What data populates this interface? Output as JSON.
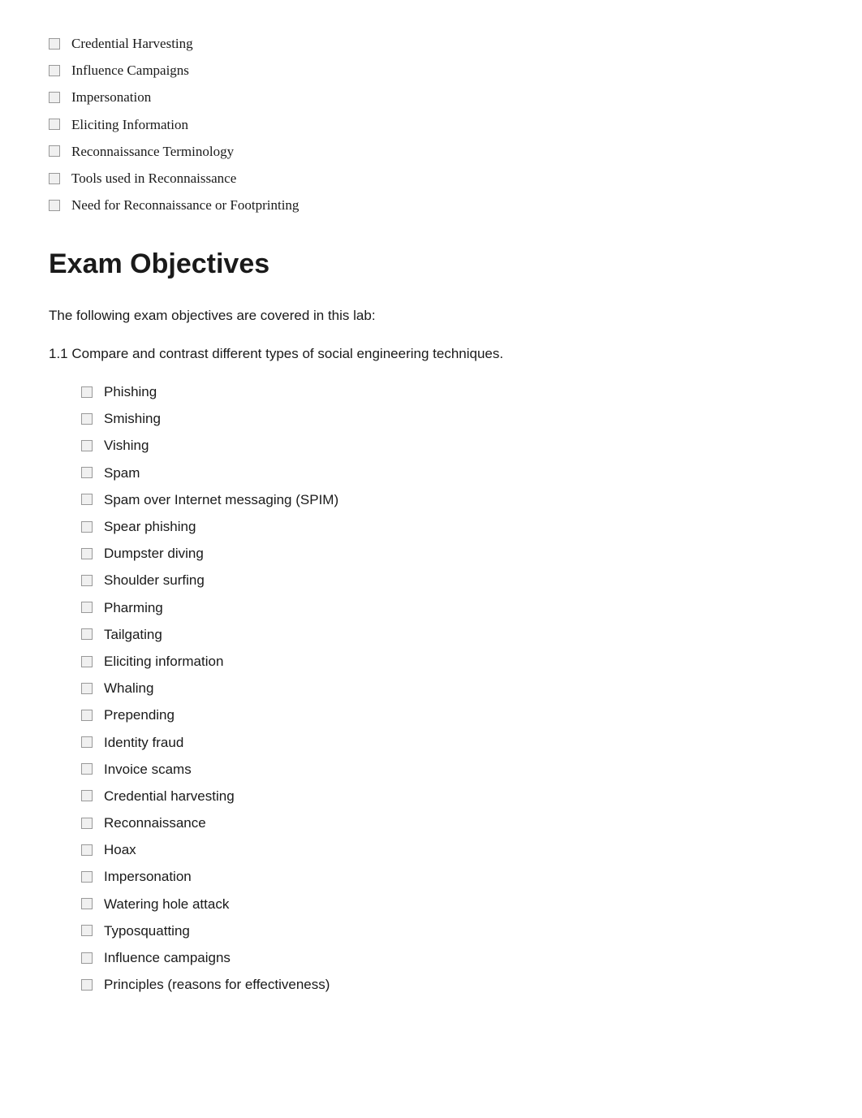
{
  "topList": {
    "items": [
      "Credential Harvesting",
      "Influence Campaigns",
      "Impersonation",
      "Eliciting Information",
      "Reconnaissance Terminology",
      "Tools used in Reconnaissance",
      "Need for Reconnaissance or Footprinting"
    ]
  },
  "examObjectives": {
    "sectionTitle": "Exam Objectives",
    "introText": "The following exam objectives are covered in this lab:",
    "objectiveText": "1.1 Compare and contrast different types of social engineering techniques.",
    "subItems": [
      "Phishing",
      "Smishing",
      "Vishing",
      "Spam",
      "Spam over Internet messaging (SPIM)",
      "Spear phishing",
      "Dumpster diving",
      "Shoulder surfing",
      "Pharming",
      "Tailgating",
      "Eliciting information",
      "Whaling",
      "Prepending",
      "Identity fraud",
      "Invoice scams",
      "Credential harvesting",
      "Reconnaissance",
      "Hoax",
      "Impersonation",
      "Watering hole attack",
      "Typosquatting",
      "Influence campaigns",
      "Principles (reasons for effectiveness)"
    ]
  }
}
